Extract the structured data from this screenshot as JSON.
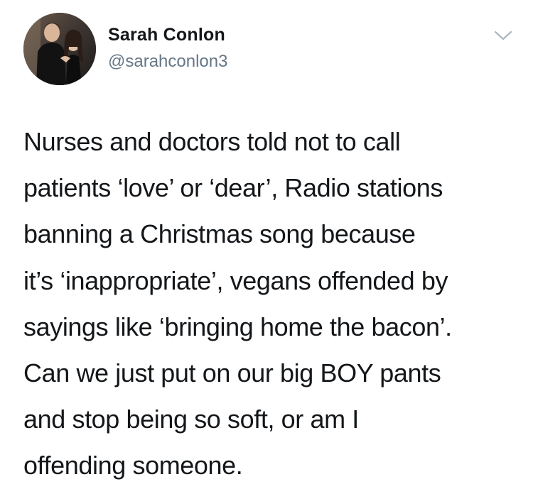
{
  "author": {
    "name": "Sarah Conlon",
    "handle": "@sarahconlon3"
  },
  "icons": {
    "menu": "chevron-down-icon"
  },
  "tweet": {
    "lines": [
      "Nurses and doctors told not to call",
      "patients ‘love’ or ‘dear’, Radio stations",
      "banning a Christmas song because",
      "it’s ‘inappropriate’, vegans offended by",
      "sayings like ‘bringing home the bacon’.",
      "Can we just put on our big BOY pants",
      "and stop being so soft, or am I",
      "offending someone."
    ]
  },
  "colors": {
    "text": "#14171a",
    "secondary": "#657786",
    "chevron": "#aab8c2"
  }
}
